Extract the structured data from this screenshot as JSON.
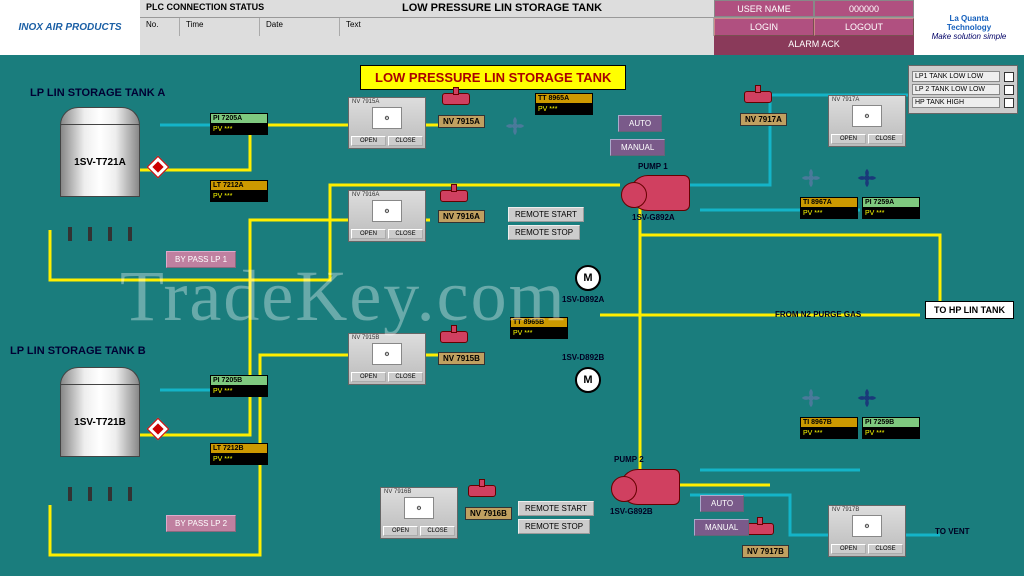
{
  "header": {
    "plc_status_label": "PLC CONNECTION STATUS",
    "main_title": "LOW PRESSURE LIN STORAGE TANK",
    "user_name_label": "USER NAME",
    "user_name_val": "000000",
    "cols": {
      "no": "No.",
      "time": "Time",
      "date": "Date",
      "text": "Text"
    },
    "login": "LOGIN",
    "logout": "LOGOUT",
    "alarm_ack": "ALARM ACK",
    "logo_left": "INOX AIR PRODUCTS",
    "logo_right_1": "La Quanta",
    "logo_right_2": "Technology",
    "logo_right_3": "Make solution simple"
  },
  "title": "LOW PRESSURE LIN STORAGE TANK",
  "sections": {
    "a": "LP LIN STORAGE TANK A",
    "b": "LP LIN STORAGE TANK B"
  },
  "tanks": {
    "a": "1SV-T721A",
    "b": "1SV-T721B"
  },
  "pv": {
    "pi7205a": {
      "tag": "PI 7205A",
      "val": "PV   ***"
    },
    "lt7212a": {
      "tag": "LT 7212A",
      "val": "PV   ***"
    },
    "pi7205b": {
      "tag": "PI 7205B",
      "val": "PV   ***"
    },
    "lt7212b": {
      "tag": "LT 7212B",
      "val": "PV   ***"
    },
    "tt8965a": {
      "tag": "TT 8965A",
      "val": "PV   ***"
    },
    "tt8965b": {
      "tag": "TT 8965B",
      "val": "PV   ***"
    },
    "ti8967a": {
      "tag": "TI 8967A",
      "val": "PV   ***"
    },
    "pi7259a": {
      "tag": "PI 7259A",
      "val": "PV   ***"
    },
    "ti8967b": {
      "tag": "TI 8967B",
      "val": "PV   ***"
    },
    "pi7259b": {
      "tag": "PI 7259B",
      "val": "PV   ***"
    }
  },
  "nv": {
    "7915a": "NV 7915A",
    "7916a": "NV 7916A",
    "7915b": "NV 7915B",
    "7916b": "NV 7916B",
    "7917a": "NV 7917A",
    "7917b": "NV 7917B"
  },
  "panels": {
    "open": "OPEN",
    "close": "CLOSE",
    "p1": "NV 7915A",
    "p2": "NV 7916A",
    "p3": "NV 7915B",
    "p4": "NV 7916B",
    "p5": "NV 7917A",
    "p6": "NV 7917B"
  },
  "btns": {
    "auto": "AUTO",
    "manual": "MANUAL",
    "remote_start": "REMOTE START",
    "remote_stop": "REMOTE STOP",
    "bypass1": "BY PASS LP 1",
    "bypass2": "BY PASS LP 2"
  },
  "labels": {
    "pump1": "PUMP 1",
    "pump2": "PUMP 2",
    "g892a": "1SV-G892A",
    "g892b": "1SV-G892B",
    "d892a": "1SV-D892A",
    "d892b": "1SV-D892B",
    "n2": "FROM N2 PURGE GAS",
    "tovent": "TO VENT",
    "motor": "M"
  },
  "outputs": {
    "hplin": "TO HP LIN TANK"
  },
  "alarms": {
    "a1": "LP1 TANK LOW LOW",
    "a2": "LP 2 TANK LOW LOW",
    "a3": "HP TANK HIGH"
  },
  "watermark": "TradeKey.com"
}
